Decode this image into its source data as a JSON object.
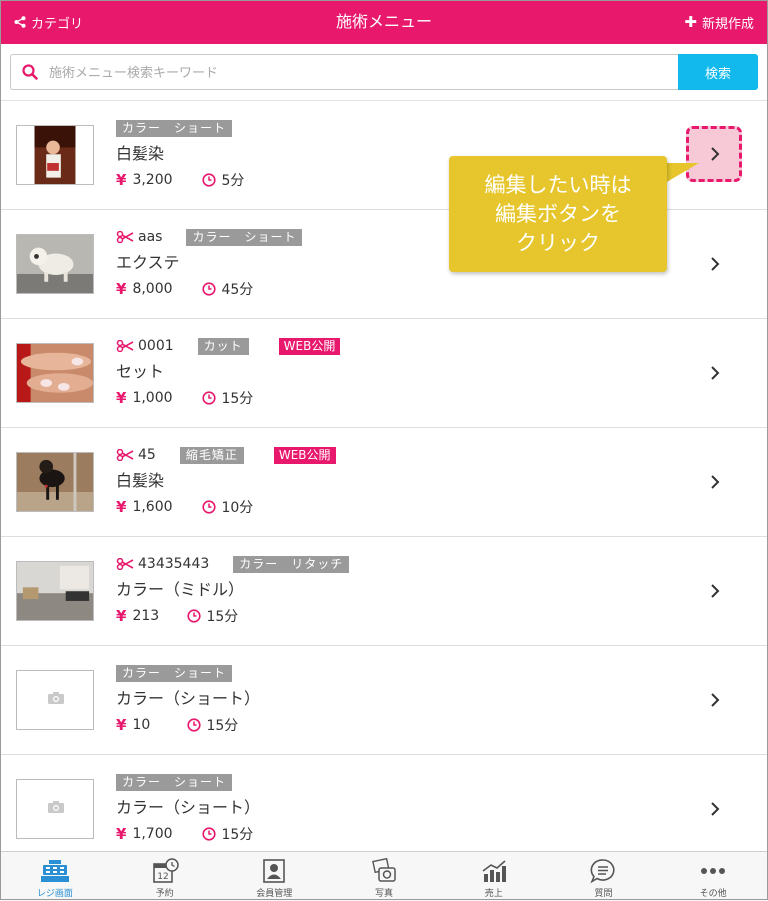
{
  "header": {
    "category_label": "カテゴリ",
    "title": "施術メニュー",
    "new_label": "新規作成",
    "color": "#e8186d"
  },
  "search": {
    "placeholder": "施術メニュー検索キーワード",
    "value": "",
    "button_label": "検索",
    "button_color": "#12b9ec"
  },
  "menu_items": [
    {
      "code": "",
      "tags": [
        "カラー　ショート"
      ],
      "web_badge": "",
      "name": "白髪染",
      "price": "3,200",
      "duration": "5分",
      "thumb": "photo-child"
    },
    {
      "code": "aas",
      "tags": [
        "カラー　ショート"
      ],
      "web_badge": "",
      "name": "エクステ",
      "price": "8,000",
      "duration": "45分",
      "thumb": "photo-dog-white"
    },
    {
      "code": "0001",
      "tags": [
        "カット"
      ],
      "web_badge": "WEB公開",
      "name": "セット",
      "price": "1,000",
      "duration": "15分",
      "thumb": "photo-nails"
    },
    {
      "code": "45",
      "tags": [
        "縮毛矯正"
      ],
      "web_badge": "WEB公開",
      "name": "白髪染",
      "price": "1,600",
      "duration": "10分",
      "thumb": "photo-dog-black"
    },
    {
      "code": "43435443",
      "tags": [
        "カラー　リタッチ"
      ],
      "web_badge": "",
      "name": "カラー（ミドル）",
      "price": "213",
      "duration": "15分",
      "thumb": "photo-room"
    },
    {
      "code": "",
      "tags": [
        "カラー　ショート"
      ],
      "web_badge": "",
      "name": "カラー（ショート）",
      "price": "10",
      "duration": "15分",
      "thumb": "camera-placeholder"
    },
    {
      "code": "",
      "tags": [
        "カラー　ショート"
      ],
      "web_badge": "",
      "name": "カラー（ショート）",
      "price": "1,700",
      "duration": "15分",
      "thumb": "camera-placeholder"
    }
  ],
  "currency_symbol": "¥",
  "callout": {
    "lines": [
      "編集したい時は",
      "編集ボタンを",
      "クリック"
    ],
    "color": "#e6c62c"
  },
  "tabbar": {
    "tabs": [
      {
        "label": "レジ画面",
        "icon": "register-icon",
        "active": true
      },
      {
        "label": "予約",
        "icon": "calendar-icon",
        "calendar_day": "12"
      },
      {
        "label": "会員管理",
        "icon": "member-icon"
      },
      {
        "label": "写真",
        "icon": "camera-icon"
      },
      {
        "label": "売上",
        "icon": "sales-chart-icon"
      },
      {
        "label": "質問",
        "icon": "speech-bubble-icon"
      },
      {
        "label": "その他",
        "icon": "more-icon"
      }
    ]
  }
}
